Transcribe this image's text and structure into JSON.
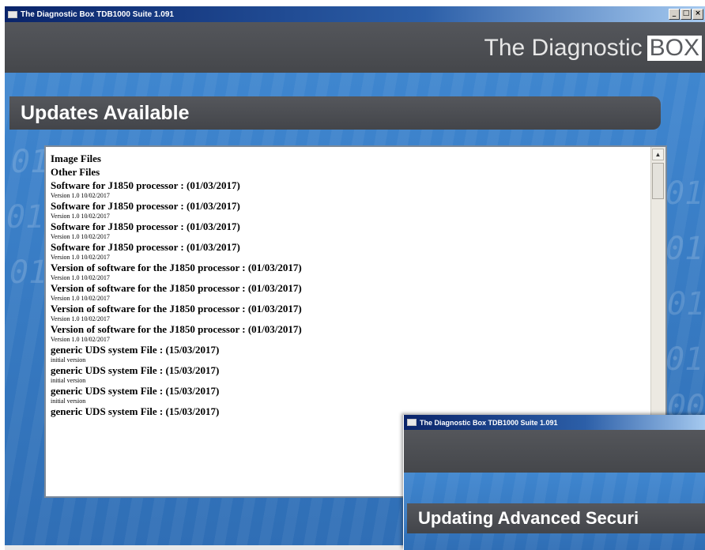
{
  "main_window": {
    "title": "The Diagnostic Box TDB1000 Suite 1.091",
    "controls": {
      "minimize": "_",
      "maximize": "□",
      "close": "×"
    },
    "brand": {
      "text": "The Diagnostic",
      "box": "BOX"
    },
    "heading": "Updates Available",
    "items": [
      {
        "title": "Image Files",
        "subtitle": ""
      },
      {
        "title": "Other Files",
        "subtitle": ""
      },
      {
        "title": "Software for J1850 processor : (01/03/2017)",
        "subtitle": "Version 1.0 10/02/2017"
      },
      {
        "title": "Software for J1850 processor : (01/03/2017)",
        "subtitle": "Version 1.0 10/02/2017"
      },
      {
        "title": "Software for J1850 processor : (01/03/2017)",
        "subtitle": "Version 1.0 10/02/2017"
      },
      {
        "title": "Software for J1850 processor : (01/03/2017)",
        "subtitle": "Version 1.0 10/02/2017"
      },
      {
        "title": "Version of software for the J1850 processor : (01/03/2017)",
        "subtitle": "Version 1.0 10/02/2017"
      },
      {
        "title": "Version of software for the J1850 processor : (01/03/2017)",
        "subtitle": "Version 1.0 10/02/2017"
      },
      {
        "title": "Version of software for the J1850 processor : (01/03/2017)",
        "subtitle": "Version 1.0 10/02/2017"
      },
      {
        "title": "Version of software for the J1850 processor : (01/03/2017)",
        "subtitle": "Version 1.0 10/02/2017"
      },
      {
        "title": "generic UDS system File : (15/03/2017)",
        "subtitle": "initial version"
      },
      {
        "title": "generic UDS system File : (15/03/2017)",
        "subtitle": "initial version"
      },
      {
        "title": "generic UDS system File : (15/03/2017)",
        "subtitle": "initial version"
      },
      {
        "title": "generic UDS system File : (15/03/2017)",
        "subtitle": ""
      }
    ],
    "scroll_up": "▲"
  },
  "second_window": {
    "title": "The Diagnostic Box TDB1000 Suite 1.091",
    "heading": "Updating Advanced Securi"
  },
  "colors": {
    "titlebar": "#0a246a",
    "banner": "#4d4f54",
    "background": "#3a7fc6"
  }
}
